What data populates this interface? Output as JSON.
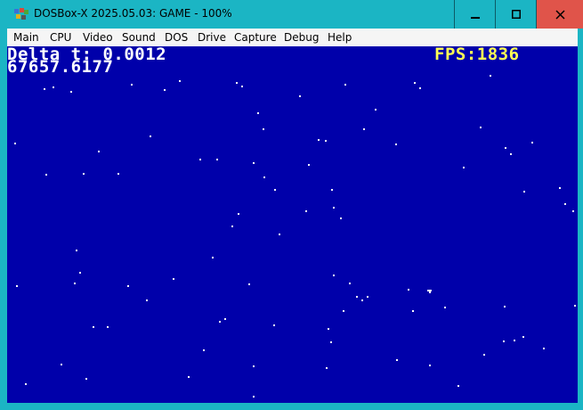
{
  "window": {
    "title": "DOSBox-X 2025.05.03: GAME - 100%",
    "controls": {
      "minimize_label": "🗕",
      "maximize_label": "☐",
      "close_label": "✕"
    },
    "accent_color": "#1bb5c4",
    "close_color": "#e0544a"
  },
  "menu": {
    "items": [
      "Main",
      "CPU",
      "Video",
      "Sound",
      "DOS",
      "Drive",
      "Capture",
      "Debug",
      "Help"
    ]
  },
  "screen": {
    "background": "#0000aa",
    "delta_line": "Delta t: 0.0012",
    "value_line": "67657.6177",
    "fps_line": "FPS:1836",
    "text_color": "#ffffff",
    "fps_color": "#ffff55"
  }
}
